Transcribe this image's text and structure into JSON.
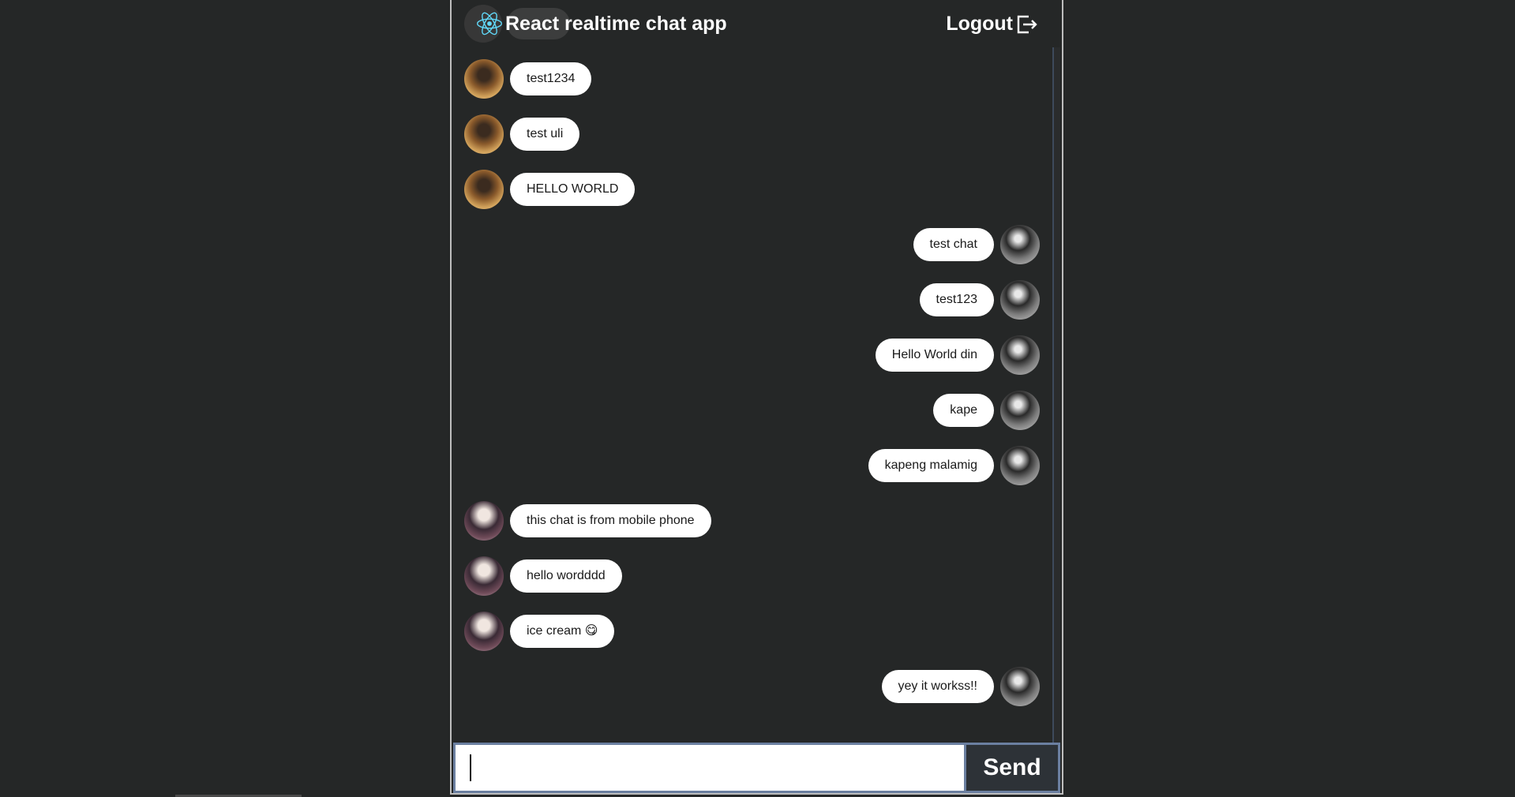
{
  "header": {
    "title": "React realtime chat app",
    "logout_label": "Logout"
  },
  "messages": [
    {
      "side": "left",
      "avatar": "user-avatar-a",
      "text": "test1234"
    },
    {
      "side": "left",
      "avatar": "user-avatar-a",
      "text": "test uli"
    },
    {
      "side": "left",
      "avatar": "user-avatar-a",
      "text": "HELLO WORLD"
    },
    {
      "side": "right",
      "avatar": "user-avatar-b",
      "text": "test chat"
    },
    {
      "side": "right",
      "avatar": "user-avatar-b",
      "text": "test123"
    },
    {
      "side": "right",
      "avatar": "user-avatar-b",
      "text": "Hello World din"
    },
    {
      "side": "right",
      "avatar": "user-avatar-b",
      "text": "kape"
    },
    {
      "side": "right",
      "avatar": "user-avatar-b",
      "text": "kapeng malamig"
    },
    {
      "side": "left",
      "avatar": "user-avatar-c",
      "text": "this chat is from mobile phone"
    },
    {
      "side": "left",
      "avatar": "user-avatar-c",
      "text": "hello wordddd"
    },
    {
      "side": "left",
      "avatar": "user-avatar-c",
      "text": "ice cream 😋"
    },
    {
      "side": "right",
      "avatar": "user-avatar-b",
      "text": "yey it workss!!"
    }
  ],
  "composer": {
    "input_value": "",
    "send_label": "Send"
  }
}
